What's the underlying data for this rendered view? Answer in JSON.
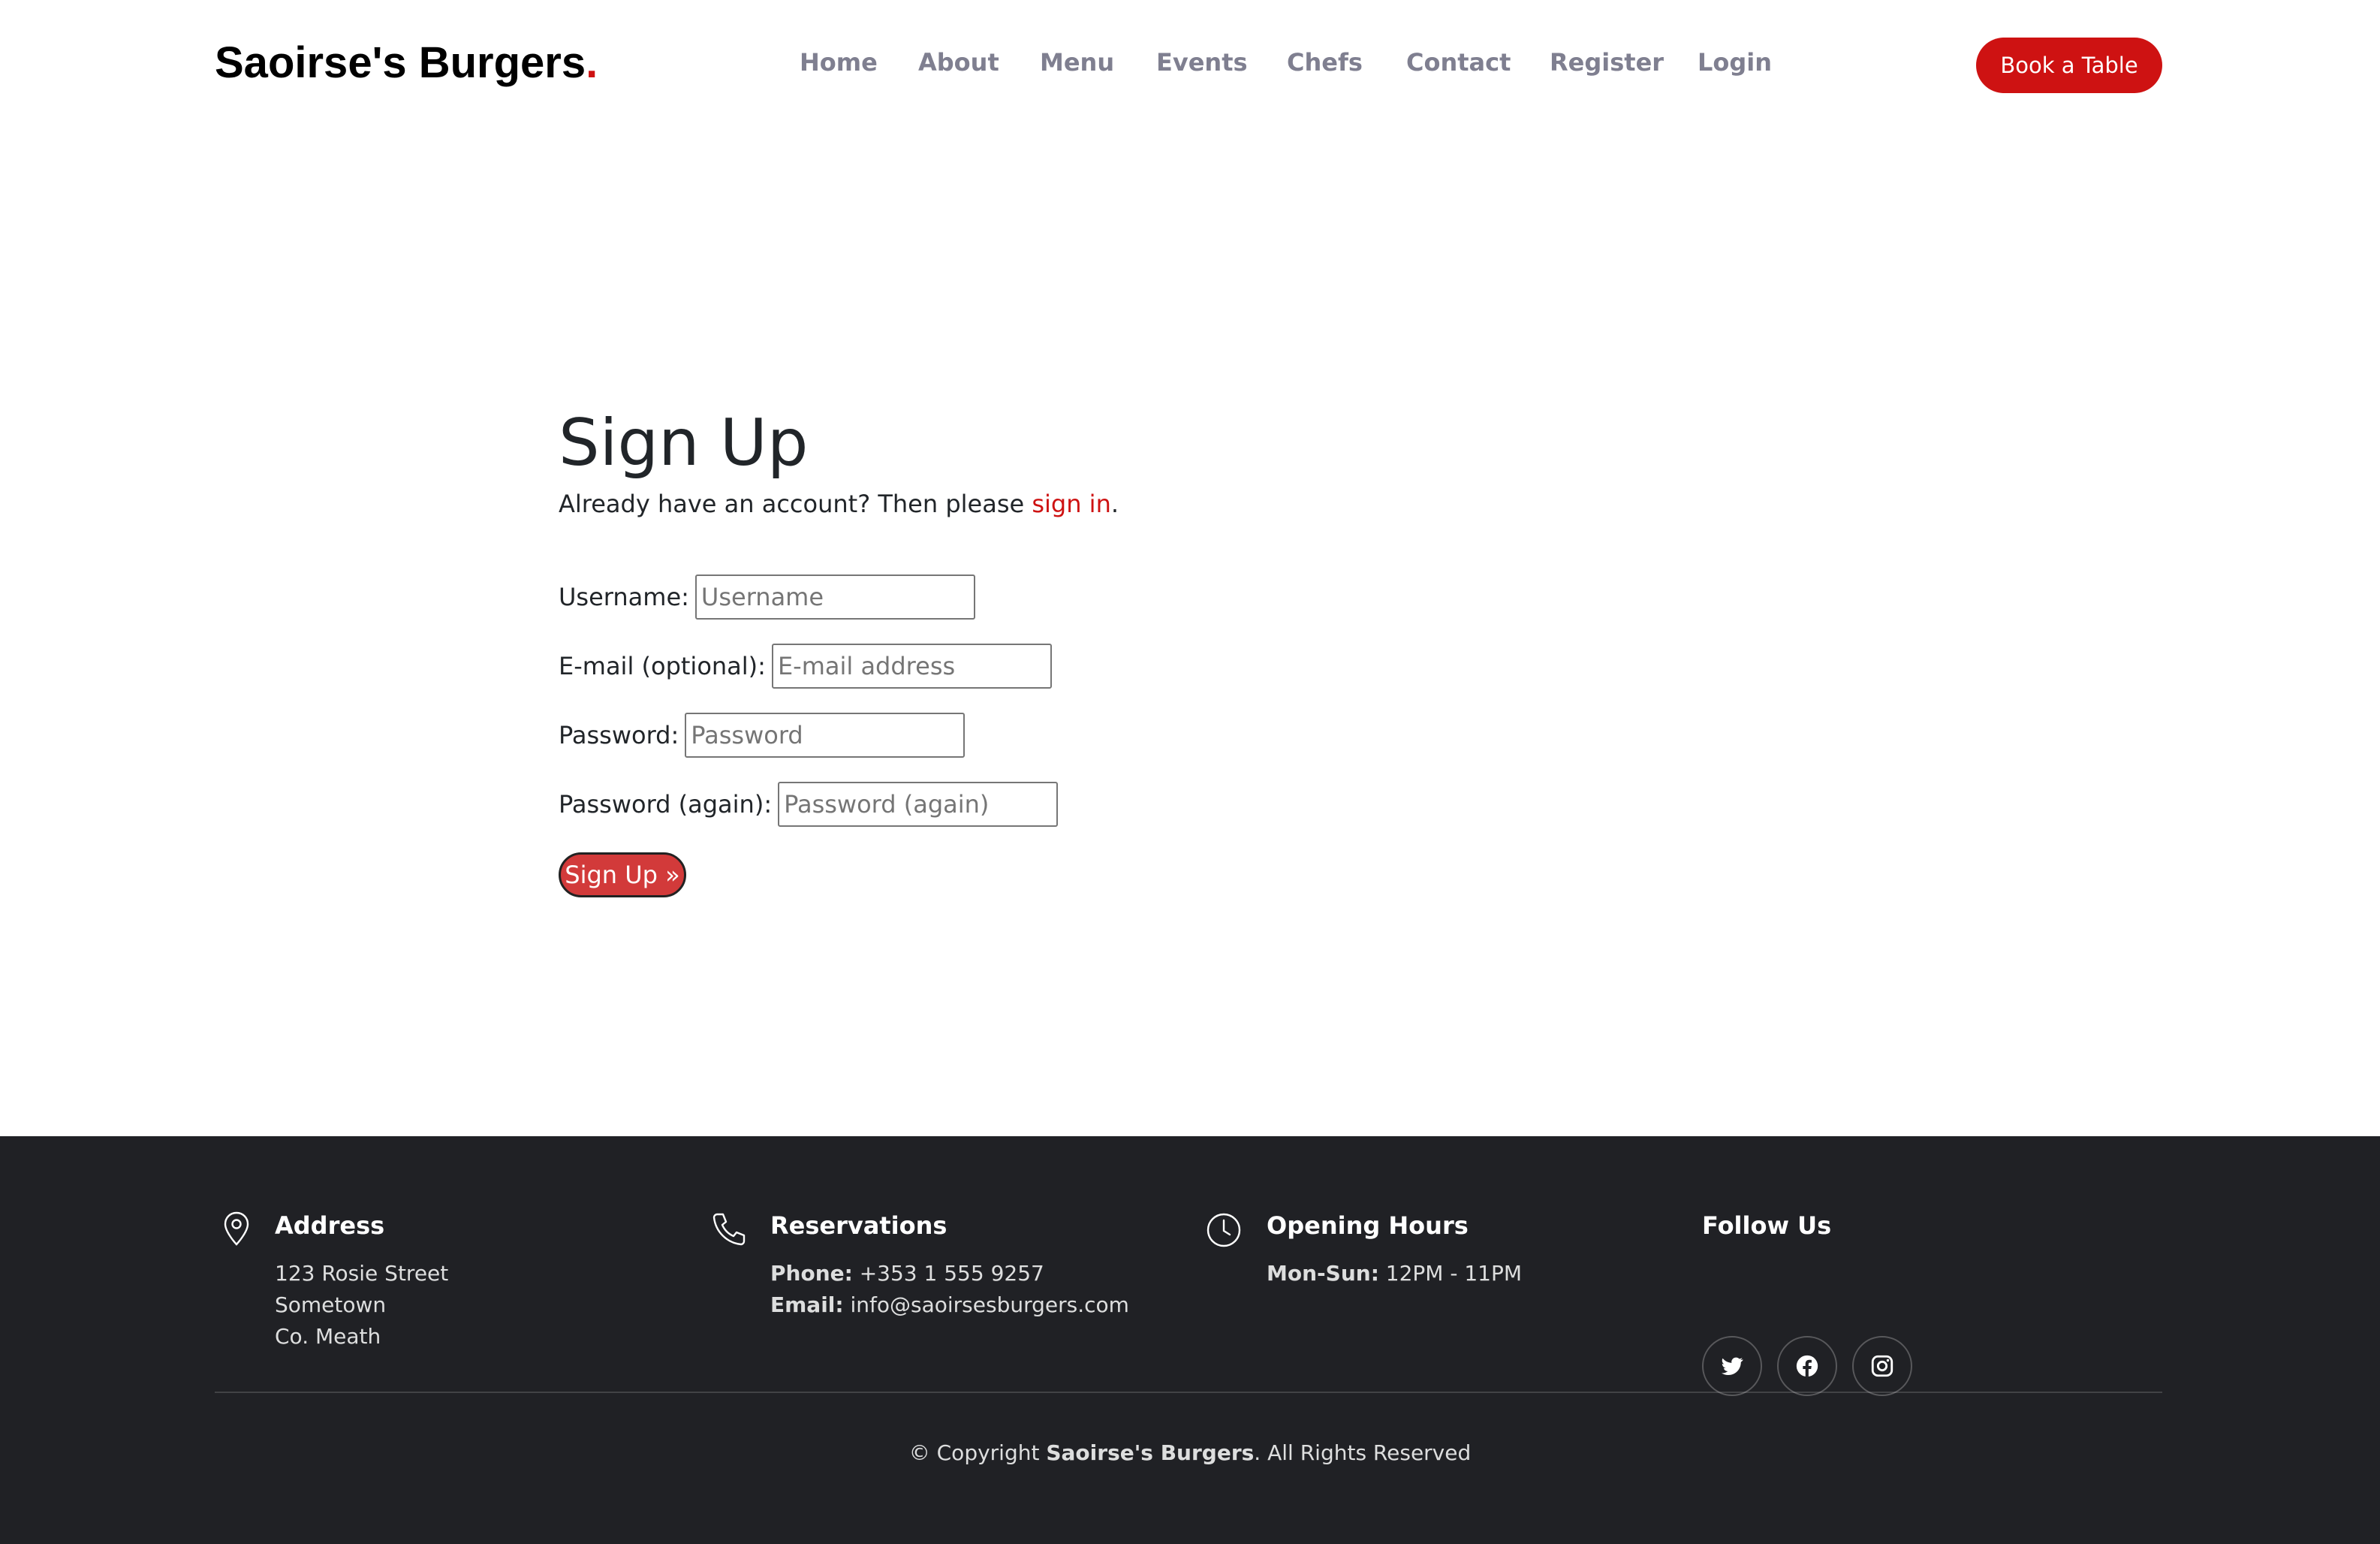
{
  "header": {
    "logo_text": "Saoirse's Burgers",
    "logo_dot": ".",
    "nav": [
      "Home",
      "About",
      "Menu",
      "Events",
      "Chefs",
      "Contact",
      "Register",
      "Login"
    ],
    "book_label": "Book a Table"
  },
  "main": {
    "title": "Sign Up",
    "intro_prefix": "Already have an account? Then please ",
    "intro_link": "sign in",
    "intro_suffix": ".",
    "fields": [
      {
        "label": "Username:",
        "placeholder": "Username"
      },
      {
        "label": "E-mail (optional):",
        "placeholder": "E-mail address"
      },
      {
        "label": "Password:",
        "placeholder": "Password"
      },
      {
        "label": "Password (again):",
        "placeholder": "Password (again)"
      }
    ],
    "submit_label": "Sign Up »"
  },
  "footer": {
    "address": {
      "heading": "Address",
      "lines": [
        "123 Rosie Street",
        "Sometown",
        "Co. Meath"
      ]
    },
    "reservations": {
      "heading": "Reservations",
      "phone_label": "Phone:",
      "phone": " +353 1 555 9257",
      "email_label": "Email:",
      "email": " info@saoirsesburgers.com"
    },
    "hours": {
      "heading": "Opening Hours",
      "days_label": "Mon-Sun:",
      "times": " 12PM - 11PM"
    },
    "follow": {
      "heading": "Follow Us",
      "icons": [
        "twitter-icon",
        "facebook-icon",
        "instagram-icon"
      ]
    },
    "copyright_prefix": "© Copyright ",
    "copyright_brand": "Saoirse's Burgers",
    "copyright_suffix": ". All Rights Reserved"
  },
  "colors": {
    "accent": "#ce1212",
    "nav_text": "#7f7f90",
    "footer_bg": "#202125",
    "signup_button": "#d23a3a"
  }
}
